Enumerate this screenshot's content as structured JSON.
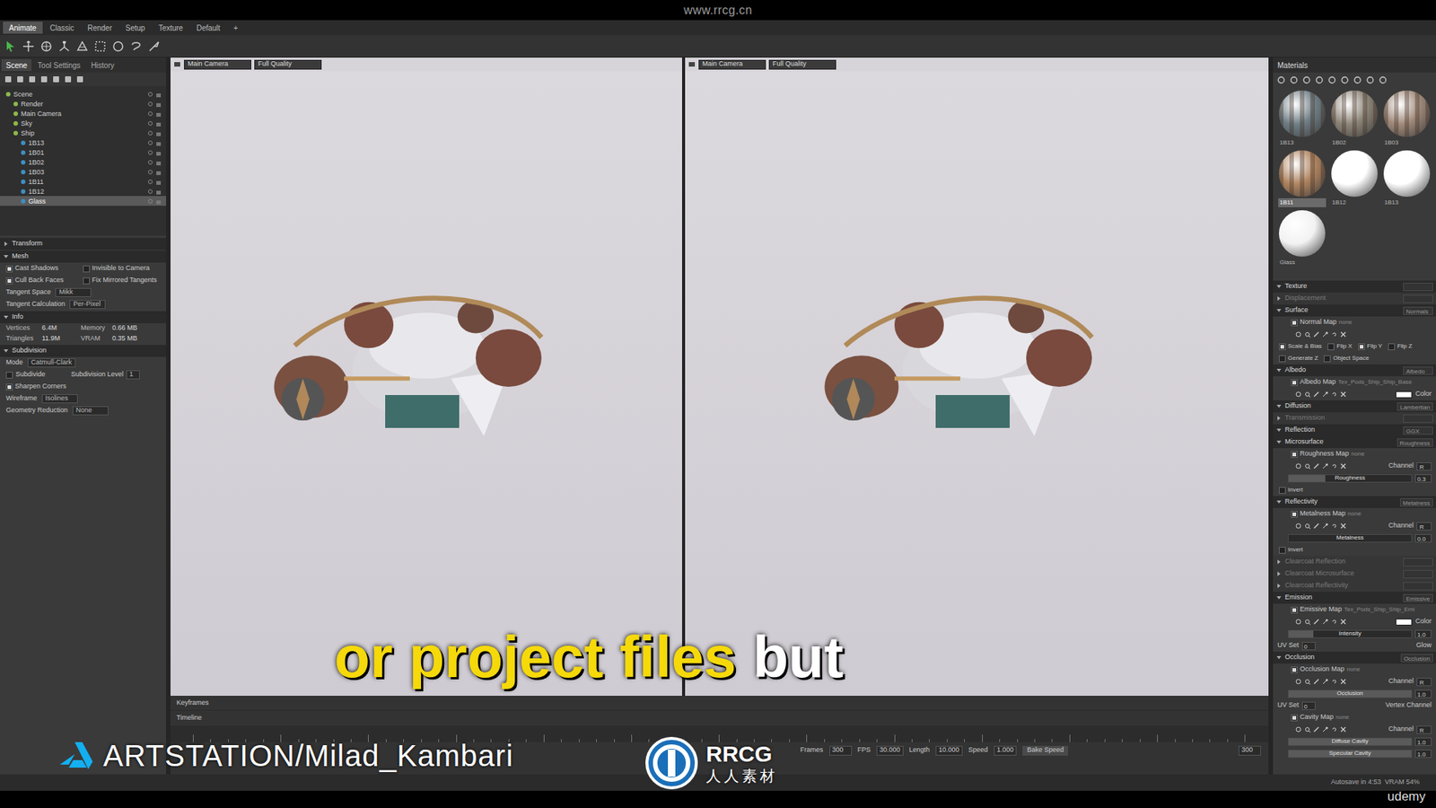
{
  "top_bar": {
    "url": "www.rrcg.cn"
  },
  "menu_tabs": [
    {
      "label": "Animate",
      "selected": true
    },
    {
      "label": "Classic",
      "selected": false
    },
    {
      "label": "Render",
      "selected": false
    },
    {
      "label": "Setup",
      "selected": false
    },
    {
      "label": "Texture",
      "selected": false
    },
    {
      "label": "Default",
      "selected": false
    },
    {
      "label": "+",
      "selected": false
    }
  ],
  "scene_panel": {
    "tabs": [
      {
        "label": "Scene",
        "selected": true
      },
      {
        "label": "Tool Settings",
        "selected": false
      },
      {
        "label": "History",
        "selected": false
      }
    ],
    "tree": [
      {
        "label": "Scene",
        "depth": 0,
        "selected": false
      },
      {
        "label": "Render",
        "depth": 1,
        "selected": false
      },
      {
        "label": "Main Camera",
        "depth": 1,
        "selected": false
      },
      {
        "label": "Sky",
        "depth": 1,
        "selected": false
      },
      {
        "label": "Ship",
        "depth": 1,
        "selected": false
      },
      {
        "label": "1B13",
        "depth": 2,
        "selected": false
      },
      {
        "label": "1B01",
        "depth": 2,
        "selected": false
      },
      {
        "label": "1B02",
        "depth": 2,
        "selected": false
      },
      {
        "label": "1B03",
        "depth": 2,
        "selected": false
      },
      {
        "label": "1B11",
        "depth": 2,
        "selected": false
      },
      {
        "label": "1B12",
        "depth": 2,
        "selected": false
      },
      {
        "label": "Glass",
        "depth": 2,
        "selected": true
      }
    ],
    "properties": [
      {
        "kind": "header",
        "label": "Transform",
        "expanded": false
      },
      {
        "kind": "header",
        "label": "Mesh",
        "expanded": true
      },
      {
        "kind": "check2",
        "items": [
          {
            "label": "Cast Shadows",
            "checked": true
          },
          {
            "label": "Invisible to Camera",
            "checked": false
          }
        ]
      },
      {
        "kind": "check2",
        "items": [
          {
            "label": "Cull Back Faces",
            "checked": true
          },
          {
            "label": "Fix Mirrored Tangents",
            "checked": false
          }
        ]
      },
      {
        "kind": "field",
        "label": "Tangent Space",
        "value": "Mikk"
      },
      {
        "kind": "field",
        "label": "Tangent Calculation",
        "value": "Per-Pixel"
      },
      {
        "kind": "header",
        "label": "Info",
        "expanded": true
      },
      {
        "kind": "info",
        "cells": [
          "Vertices",
          "6.4M",
          "Memory",
          "0.66 MB"
        ]
      },
      {
        "kind": "info",
        "cells": [
          "Triangles",
          "11.9M",
          "VRAM",
          "0.35 MB"
        ]
      },
      {
        "kind": "header",
        "label": "Subdivision",
        "expanded": true
      },
      {
        "kind": "field",
        "label": "Mode",
        "value": "Catmull-Clark"
      },
      {
        "kind": "checkfield",
        "label": "Subdivide",
        "checked": false,
        "field": "Subdivision Level",
        "value": "1"
      },
      {
        "kind": "check2",
        "items": [
          {
            "label": "Sharpen Corners",
            "checked": true
          }
        ]
      },
      {
        "kind": "field",
        "label": "Wireframe",
        "value": "Isolines"
      },
      {
        "kind": "field",
        "label": "Geometry Reduction",
        "value": "None"
      }
    ]
  },
  "viewports": [
    {
      "camera": "Main Camera",
      "quality": "Full Quality"
    },
    {
      "camera": "Main Camera",
      "quality": "Full Quality"
    }
  ],
  "materials_panel": {
    "title": "Materials",
    "swatches": [
      {
        "label": "1B13",
        "selected": false,
        "color": "#6f7f86",
        "kind": "textured"
      },
      {
        "label": "1B02",
        "selected": false,
        "color": "#8c8578",
        "kind": "textured"
      },
      {
        "label": "1B03",
        "selected": false,
        "color": "#a08a7a",
        "kind": "textured"
      },
      {
        "label": "1B11",
        "selected": true,
        "color": "#b08560",
        "kind": "textured"
      },
      {
        "label": "1B12",
        "selected": false,
        "color": "#ffffff",
        "kind": "plain"
      },
      {
        "label": "1B13",
        "selected": false,
        "color": "#ffffff",
        "kind": "plain"
      },
      {
        "label": "Glass",
        "selected": false,
        "color": "#f2f2f2",
        "kind": "plain"
      }
    ],
    "rows": [
      {
        "kind": "header",
        "label": "Texture",
        "value": ""
      },
      {
        "kind": "subheader",
        "label": "Displacement",
        "value": ""
      },
      {
        "kind": "header",
        "label": "Surface",
        "value": "Normals"
      },
      {
        "kind": "map",
        "label": "Normal Map",
        "value": "none",
        "checked": true
      },
      {
        "kind": "tools"
      },
      {
        "kind": "checks",
        "items": [
          {
            "label": "Scale & Bias",
            "checked": true
          },
          {
            "label": "Flip X",
            "checked": false
          },
          {
            "label": "Flip Y",
            "checked": true
          },
          {
            "label": "Flip Z",
            "checked": false
          }
        ]
      },
      {
        "kind": "checks",
        "items": [
          {
            "label": "Generate Z",
            "checked": false
          },
          {
            "label": "Object Space",
            "checked": false
          }
        ]
      },
      {
        "kind": "header",
        "label": "Albedo",
        "value": "Albedo"
      },
      {
        "kind": "map",
        "label": "Albedo Map",
        "value": "Tex_Pods_Ship_Ship_Base",
        "checked": true
      },
      {
        "kind": "tools",
        "color": "#ffffff",
        "color_label": "Color"
      },
      {
        "kind": "header",
        "label": "Diffusion",
        "value": "Lambertian"
      },
      {
        "kind": "subheader",
        "label": "Transmission",
        "value": ""
      },
      {
        "kind": "header",
        "label": "Reflection",
        "value": "GGX"
      },
      {
        "kind": "header",
        "label": "Microsurface",
        "value": "Roughness"
      },
      {
        "kind": "map",
        "label": "Roughness Map",
        "value": "none",
        "checked": true
      },
      {
        "kind": "tools",
        "channel": "Channel",
        "channel_value": "R"
      },
      {
        "kind": "slider",
        "label": "Roughness",
        "value": "0.3",
        "level": 0.3
      },
      {
        "kind": "checks",
        "items": [
          {
            "label": "Invert",
            "checked": false
          }
        ]
      },
      {
        "kind": "header",
        "label": "Reflectivity",
        "value": "Metalness"
      },
      {
        "kind": "map",
        "label": "Metalness Map",
        "value": "none",
        "checked": true
      },
      {
        "kind": "tools",
        "channel": "Channel",
        "channel_value": "R"
      },
      {
        "kind": "slider",
        "label": "Metalness",
        "value": "0.0",
        "level": 0.0
      },
      {
        "kind": "checks",
        "items": [
          {
            "label": "Invert",
            "checked": false
          }
        ]
      },
      {
        "kind": "subheader",
        "label": "Clearcoat Reflection",
        "value": ""
      },
      {
        "kind": "subheader",
        "label": "Clearcoat Microsurface",
        "value": ""
      },
      {
        "kind": "subheader",
        "label": "Clearcoat Reflectivity",
        "value": ""
      },
      {
        "kind": "header",
        "label": "Emission",
        "value": "Emissive"
      },
      {
        "kind": "map",
        "label": "Emissive Map",
        "value": "Tex_Pods_Ship_Ship_Emi",
        "checked": true
      },
      {
        "kind": "tools",
        "color": "#ffffff",
        "color_label": "Color"
      },
      {
        "kind": "slider",
        "label": "Intensity",
        "value": "1.0",
        "level": 0.2
      },
      {
        "kind": "field",
        "label": "UV Set",
        "value": "0",
        "label2": "Glow"
      },
      {
        "kind": "header",
        "label": "Occlusion",
        "value": "Occlusion"
      },
      {
        "kind": "map",
        "label": "Occlusion Map",
        "value": "none",
        "checked": true
      },
      {
        "kind": "tools",
        "channel": "Channel",
        "channel_value": "R"
      },
      {
        "kind": "slider",
        "label": "Occlusion",
        "value": "1.0",
        "level": 1.0
      },
      {
        "kind": "field",
        "label": "UV Set",
        "value": "0",
        "label2": "Vertex Channel"
      },
      {
        "kind": "map",
        "label": "Cavity Map",
        "value": "none",
        "checked": true
      },
      {
        "kind": "tools",
        "channel": "Channel",
        "channel_value": "R"
      },
      {
        "kind": "slider",
        "label": "Diffuse Cavity",
        "value": "1.0",
        "level": 1.0
      },
      {
        "kind": "slider",
        "label": "Specular Cavity",
        "value": "1.0",
        "level": 1.0
      }
    ]
  },
  "timeline": {
    "keyframes": "Keyframes",
    "timeline": "Timeline",
    "controls": [
      {
        "label": "Frames",
        "value": "300"
      },
      {
        "label": "FPS",
        "value": "30.000"
      },
      {
        "label": "Length",
        "value": "10.000"
      },
      {
        "label": "Speed",
        "value": "1.000"
      }
    ],
    "bake": "Bake Speed",
    "end_value": "300"
  },
  "status": "Autosave in 4:53  VRAM 54%",
  "subtitle": [
    {
      "text": "or project files",
      "color": "#f5d90a"
    },
    {
      "text": "but",
      "color": "#ffffff"
    }
  ],
  "credit": "ARTSTATION/Milad_Kambari",
  "logo": {
    "title": "RRCG",
    "subtitle": "人人素材"
  },
  "corner": "udemy"
}
